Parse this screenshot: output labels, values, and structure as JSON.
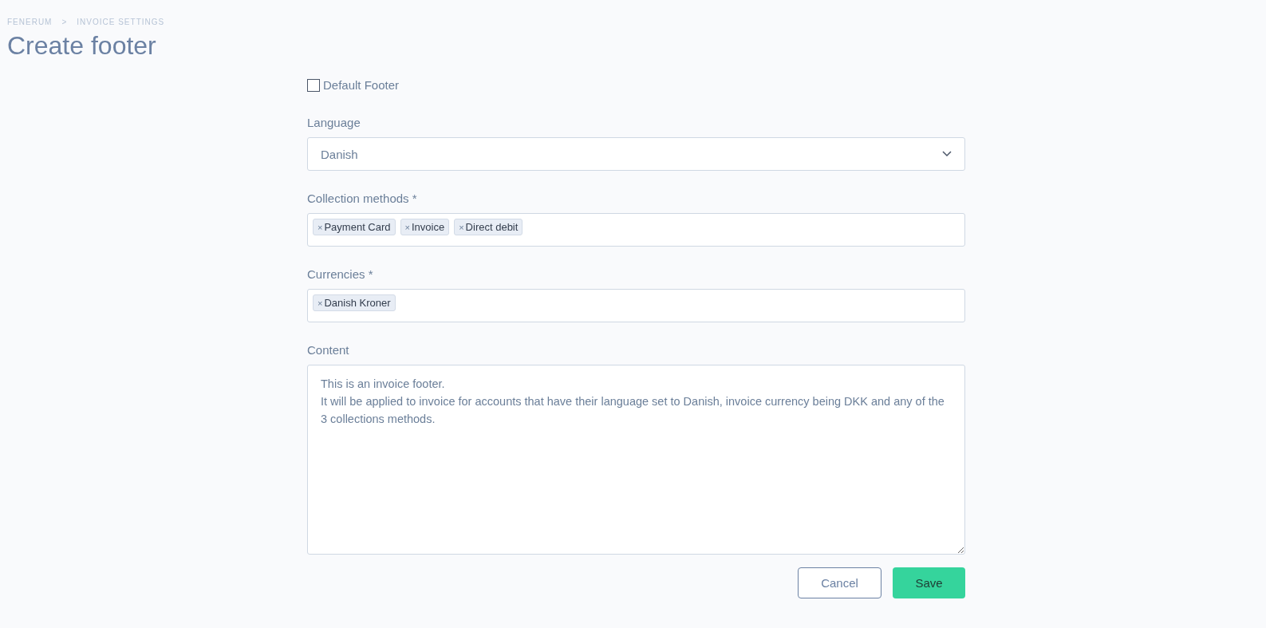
{
  "breadcrumb": [
    {
      "label": "FENERUM"
    },
    {
      "label": "INVOICE SETTINGS"
    }
  ],
  "breadcrumb_separator": ">",
  "title": "Create footer",
  "default_footer": {
    "label": "Default Footer",
    "checked": false
  },
  "language": {
    "label": "Language",
    "value": "Danish"
  },
  "collection_methods": {
    "label": "Collection methods *",
    "tags": [
      "Payment Card",
      "Invoice",
      "Direct debit"
    ]
  },
  "currencies": {
    "label": "Currencies *",
    "tags": [
      "Danish Kroner"
    ]
  },
  "tag_remove": "×",
  "content": {
    "label": "Content",
    "value": "This is an invoice footer.\nIt will be applied to invoice for accounts that have their language set to Danish, invoice currency being DKK and any of the 3 collections methods."
  },
  "buttons": [
    {
      "label": "Cancel",
      "kind": "secondary"
    },
    {
      "label": "Save",
      "kind": "primary"
    }
  ]
}
